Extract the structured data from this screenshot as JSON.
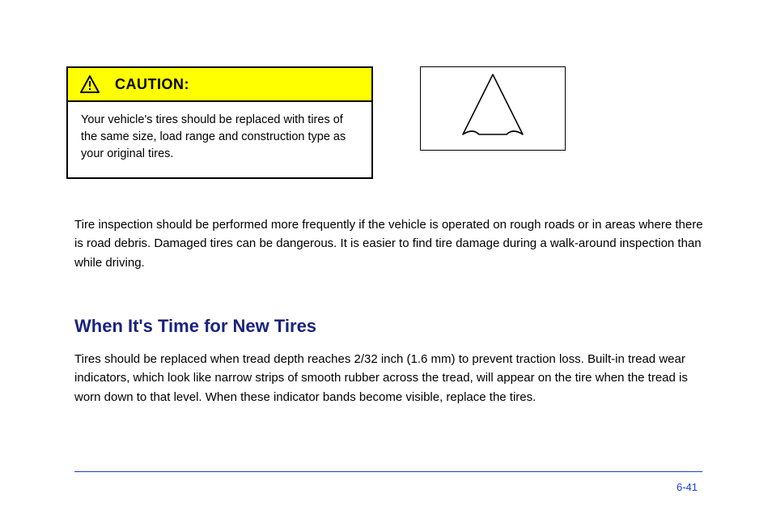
{
  "caution": {
    "title": "CAUTION:",
    "body": "Your vehicle's tires should be replaced with tires of the same size, load range and construction type as your original tires."
  },
  "figure": {
    "alt": "tread-wear-indicator-diagram"
  },
  "paragraphs": {
    "p1": "Tire inspection should be performed more frequently if the vehicle is operated on rough roads or in areas where there is road debris. Damaged tires can be dangerous. It is easier to find tire damage during a walk-around inspection than while driving.",
    "p2": "Tires should be replaced when tread depth reaches 2/32 inch (1.6 mm) to prevent traction loss. Built-in tread wear indicators, which look like narrow strips of smooth rubber across the tread, will appear on the tire when the tread is worn down to that level. When these indicator bands become visible, replace the tires."
  },
  "heading": "When It's Time for New Tires",
  "pageNumber": "6-41"
}
